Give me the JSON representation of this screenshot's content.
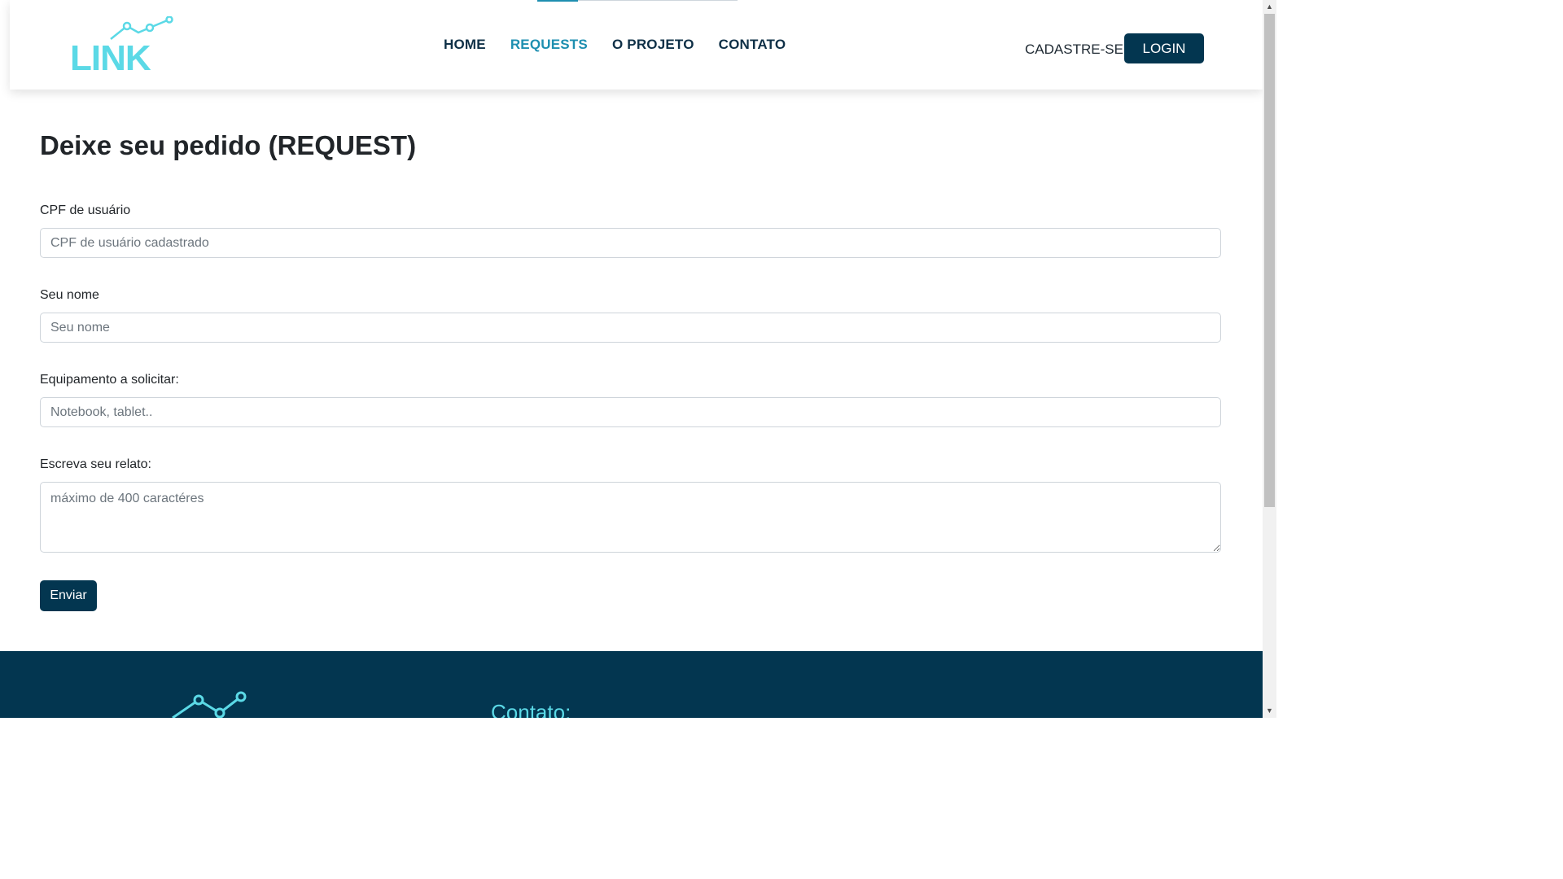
{
  "header": {
    "logo_text": "LINK",
    "nav": [
      {
        "label": "HOME",
        "active": false
      },
      {
        "label": "REQUESTS",
        "active": true
      },
      {
        "label": "O PROJETO",
        "active": false
      },
      {
        "label": "CONTATO",
        "active": false
      }
    ],
    "signup_label": "CADASTRE-SE",
    "login_label": "LOGIN"
  },
  "main": {
    "title": "Deixe seu pedido (REQUEST)",
    "fields": [
      {
        "label": "CPF de usuário",
        "placeholder": "CPF de usuário cadastrado",
        "value": ""
      },
      {
        "label": "Seu nome",
        "placeholder": "Seu nome",
        "value": ""
      },
      {
        "label": "Equipamento a solicitar:",
        "placeholder": "Notebook, tablet..",
        "value": ""
      },
      {
        "label": "Escreva seu relato:",
        "placeholder": "máximo de 400 caractéres",
        "value": ""
      }
    ],
    "submit_label": "Enviar"
  },
  "footer": {
    "contact_title": "Contato:"
  },
  "colors": {
    "primary": "#033650",
    "accent": "#5bd9e6",
    "nav_active": "#1e8fb0",
    "nav_text": "#0f3047"
  },
  "icons": {
    "logo_graph": "line-chart-icon",
    "scroll_up": "triangle-up-icon",
    "scroll_down": "triangle-down-icon"
  }
}
